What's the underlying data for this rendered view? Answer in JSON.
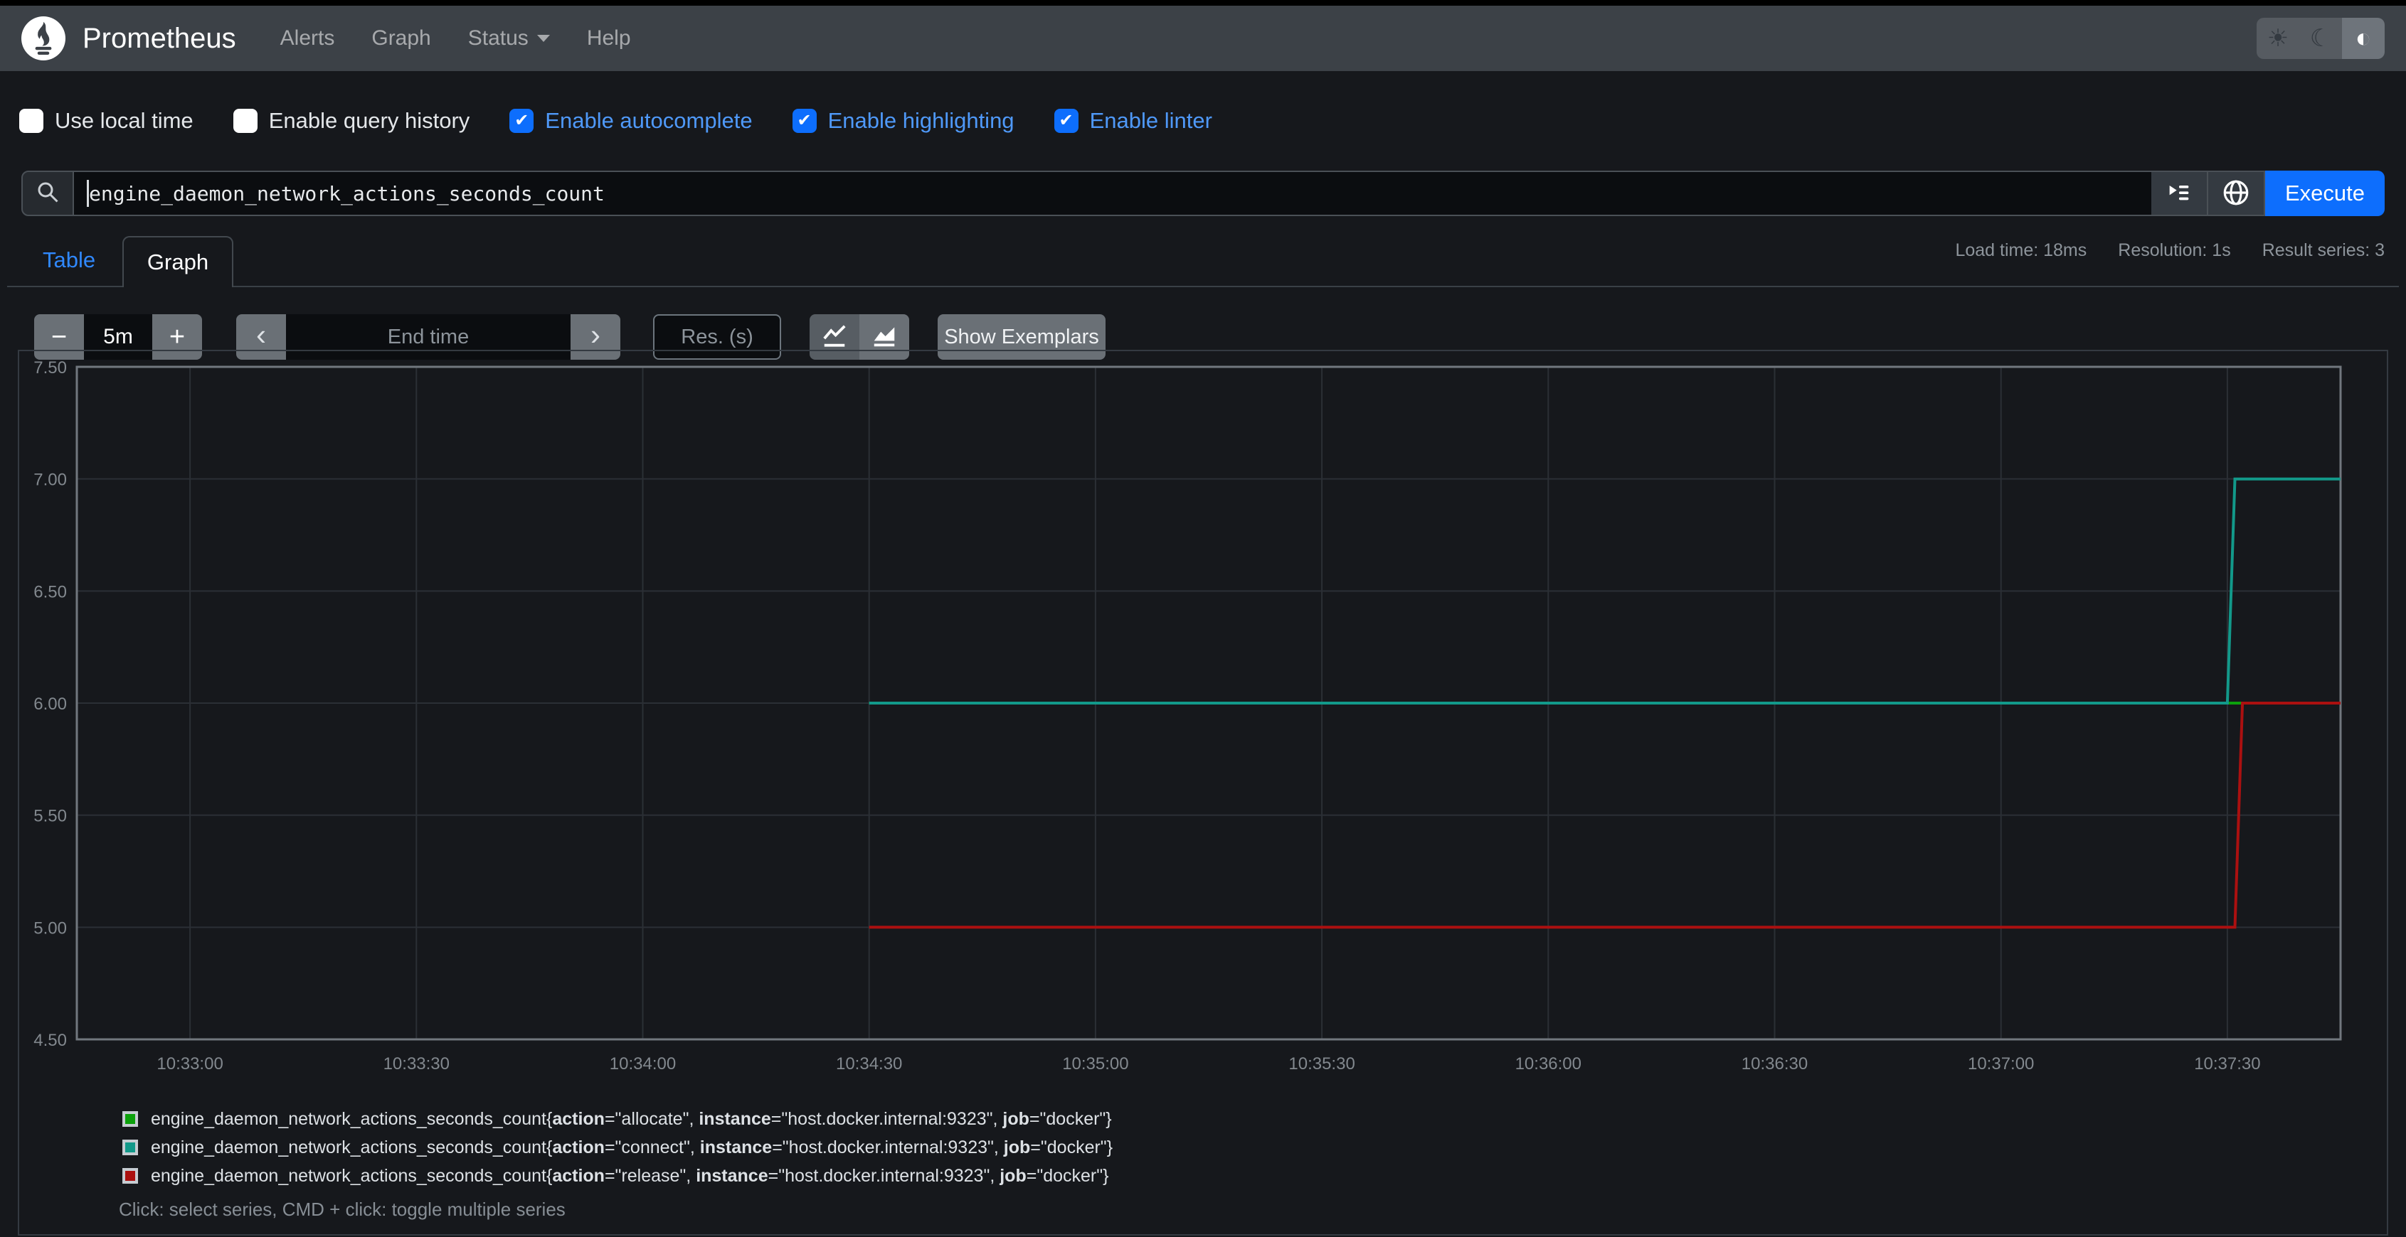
{
  "navbar": {
    "brand": "Prometheus",
    "links": [
      {
        "label": "Alerts"
      },
      {
        "label": "Graph"
      },
      {
        "label": "Status",
        "dropdown": true
      },
      {
        "label": "Help"
      }
    ]
  },
  "theme_toggle": {
    "active": "auto",
    "icons": {
      "light": "☀",
      "dark": "☾",
      "auto": "◐"
    }
  },
  "options": {
    "items": [
      {
        "label": "Use local time",
        "checked": false
      },
      {
        "label": "Enable query history",
        "checked": false
      },
      {
        "label": "Enable autocomplete",
        "checked": true
      },
      {
        "label": "Enable highlighting",
        "checked": true
      },
      {
        "label": "Enable linter",
        "checked": true
      }
    ],
    "check_glyph": "✔"
  },
  "query": {
    "value": "engine_daemon_network_actions_seconds_count",
    "execute_label": "Execute"
  },
  "tabs": {
    "items": [
      {
        "label": "Table",
        "active": false
      },
      {
        "label": "Graph",
        "active": true
      }
    ]
  },
  "stats": {
    "load_time": "Load time: 18ms",
    "resolution": "Resolution: 1s",
    "result_series": "Result series: 3"
  },
  "controls": {
    "range_decrease": "−",
    "range_value": "5m",
    "range_increase": "+",
    "prev": "‹",
    "end_time_placeholder": "End time",
    "next": "›",
    "resolution_placeholder": "Res. (s)",
    "show_exemplars": "Show Exemplars"
  },
  "chart_data": {
    "type": "line",
    "title": "",
    "xlabel": "",
    "ylabel": "",
    "grid": true,
    "legend_position": "bottom",
    "x_start": "10:32:45",
    "x_end": "10:37:45",
    "x_ticks": [
      "10:33:00",
      "10:33:30",
      "10:34:00",
      "10:34:30",
      "10:35:00",
      "10:35:30",
      "10:36:00",
      "10:36:30",
      "10:37:00",
      "10:37:30"
    ],
    "ylim": [
      4.5,
      7.5
    ],
    "y_ticks": [
      "4.50",
      "5.00",
      "5.50",
      "6.00",
      "6.50",
      "7.00",
      "7.50"
    ],
    "series": [
      {
        "name": "allocate",
        "color": "#0ca10c",
        "points": [
          [
            "10:34:30",
            6
          ],
          [
            "10:37:45",
            6
          ]
        ]
      },
      {
        "name": "connect",
        "color": "#12998a",
        "points": [
          [
            "10:34:30",
            6
          ],
          [
            "10:37:30",
            6
          ],
          [
            "10:37:31",
            7
          ],
          [
            "10:37:45",
            7
          ]
        ]
      },
      {
        "name": "release",
        "color": "#ab1010",
        "points": [
          [
            "10:34:30",
            5
          ],
          [
            "10:37:31",
            5
          ],
          [
            "10:37:32",
            6
          ],
          [
            "10:37:45",
            6
          ]
        ]
      }
    ]
  },
  "legend": {
    "series": [
      {
        "color": "#0ca10c",
        "metric": "engine_daemon_network_actions_seconds_count",
        "labels": [
          [
            "action",
            "allocate"
          ],
          [
            "instance",
            "host.docker.internal:9323"
          ],
          [
            "job",
            "docker"
          ]
        ]
      },
      {
        "color": "#12998a",
        "metric": "engine_daemon_network_actions_seconds_count",
        "labels": [
          [
            "action",
            "connect"
          ],
          [
            "instance",
            "host.docker.internal:9323"
          ],
          [
            "job",
            "docker"
          ]
        ]
      },
      {
        "color": "#ab1010",
        "metric": "engine_daemon_network_actions_seconds_count",
        "labels": [
          [
            "action",
            "release"
          ],
          [
            "instance",
            "host.docker.internal:9323"
          ],
          [
            "job",
            "docker"
          ]
        ]
      }
    ],
    "hint": "Click: select series, CMD + click: toggle multiple series"
  }
}
